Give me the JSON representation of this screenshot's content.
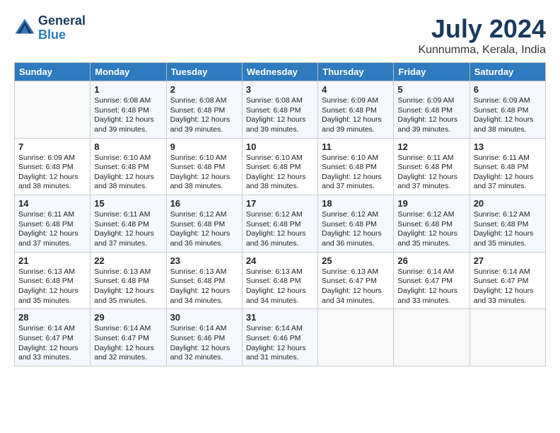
{
  "header": {
    "logo_general": "General",
    "logo_blue": "Blue",
    "month_title": "July 2024",
    "location": "Kunnumma, Kerala, India"
  },
  "days_of_week": [
    "Sunday",
    "Monday",
    "Tuesday",
    "Wednesday",
    "Thursday",
    "Friday",
    "Saturday"
  ],
  "weeks": [
    [
      {
        "day": "",
        "info": ""
      },
      {
        "day": "1",
        "info": "Sunrise: 6:08 AM\nSunset: 6:48 PM\nDaylight: 12 hours\nand 39 minutes."
      },
      {
        "day": "2",
        "info": "Sunrise: 6:08 AM\nSunset: 6:48 PM\nDaylight: 12 hours\nand 39 minutes."
      },
      {
        "day": "3",
        "info": "Sunrise: 6:08 AM\nSunset: 6:48 PM\nDaylight: 12 hours\nand 39 minutes."
      },
      {
        "day": "4",
        "info": "Sunrise: 6:09 AM\nSunset: 6:48 PM\nDaylight: 12 hours\nand 39 minutes."
      },
      {
        "day": "5",
        "info": "Sunrise: 6:09 AM\nSunset: 6:48 PM\nDaylight: 12 hours\nand 39 minutes."
      },
      {
        "day": "6",
        "info": "Sunrise: 6:09 AM\nSunset: 6:48 PM\nDaylight: 12 hours\nand 38 minutes."
      }
    ],
    [
      {
        "day": "7",
        "info": "Sunrise: 6:09 AM\nSunset: 6:48 PM\nDaylight: 12 hours\nand 38 minutes."
      },
      {
        "day": "8",
        "info": "Sunrise: 6:10 AM\nSunset: 6:48 PM\nDaylight: 12 hours\nand 38 minutes."
      },
      {
        "day": "9",
        "info": "Sunrise: 6:10 AM\nSunset: 6:48 PM\nDaylight: 12 hours\nand 38 minutes."
      },
      {
        "day": "10",
        "info": "Sunrise: 6:10 AM\nSunset: 6:48 PM\nDaylight: 12 hours\nand 38 minutes."
      },
      {
        "day": "11",
        "info": "Sunrise: 6:10 AM\nSunset: 6:48 PM\nDaylight: 12 hours\nand 37 minutes."
      },
      {
        "day": "12",
        "info": "Sunrise: 6:11 AM\nSunset: 6:48 PM\nDaylight: 12 hours\nand 37 minutes."
      },
      {
        "day": "13",
        "info": "Sunrise: 6:11 AM\nSunset: 6:48 PM\nDaylight: 12 hours\nand 37 minutes."
      }
    ],
    [
      {
        "day": "14",
        "info": "Sunrise: 6:11 AM\nSunset: 6:48 PM\nDaylight: 12 hours\nand 37 minutes."
      },
      {
        "day": "15",
        "info": "Sunrise: 6:11 AM\nSunset: 6:48 PM\nDaylight: 12 hours\nand 37 minutes."
      },
      {
        "day": "16",
        "info": "Sunrise: 6:12 AM\nSunset: 6:48 PM\nDaylight: 12 hours\nand 36 minutes."
      },
      {
        "day": "17",
        "info": "Sunrise: 6:12 AM\nSunset: 6:48 PM\nDaylight: 12 hours\nand 36 minutes."
      },
      {
        "day": "18",
        "info": "Sunrise: 6:12 AM\nSunset: 6:48 PM\nDaylight: 12 hours\nand 36 minutes."
      },
      {
        "day": "19",
        "info": "Sunrise: 6:12 AM\nSunset: 6:48 PM\nDaylight: 12 hours\nand 35 minutes."
      },
      {
        "day": "20",
        "info": "Sunrise: 6:12 AM\nSunset: 6:48 PM\nDaylight: 12 hours\nand 35 minutes."
      }
    ],
    [
      {
        "day": "21",
        "info": "Sunrise: 6:13 AM\nSunset: 6:48 PM\nDaylight: 12 hours\nand 35 minutes."
      },
      {
        "day": "22",
        "info": "Sunrise: 6:13 AM\nSunset: 6:48 PM\nDaylight: 12 hours\nand 35 minutes."
      },
      {
        "day": "23",
        "info": "Sunrise: 6:13 AM\nSunset: 6:48 PM\nDaylight: 12 hours\nand 34 minutes."
      },
      {
        "day": "24",
        "info": "Sunrise: 6:13 AM\nSunset: 6:48 PM\nDaylight: 12 hours\nand 34 minutes."
      },
      {
        "day": "25",
        "info": "Sunrise: 6:13 AM\nSunset: 6:47 PM\nDaylight: 12 hours\nand 34 minutes."
      },
      {
        "day": "26",
        "info": "Sunrise: 6:14 AM\nSunset: 6:47 PM\nDaylight: 12 hours\nand 33 minutes."
      },
      {
        "day": "27",
        "info": "Sunrise: 6:14 AM\nSunset: 6:47 PM\nDaylight: 12 hours\nand 33 minutes."
      }
    ],
    [
      {
        "day": "28",
        "info": "Sunrise: 6:14 AM\nSunset: 6:47 PM\nDaylight: 12 hours\nand 33 minutes."
      },
      {
        "day": "29",
        "info": "Sunrise: 6:14 AM\nSunset: 6:47 PM\nDaylight: 12 hours\nand 32 minutes."
      },
      {
        "day": "30",
        "info": "Sunrise: 6:14 AM\nSunset: 6:46 PM\nDaylight: 12 hours\nand 32 minutes."
      },
      {
        "day": "31",
        "info": "Sunrise: 6:14 AM\nSunset: 6:46 PM\nDaylight: 12 hours\nand 31 minutes."
      },
      {
        "day": "",
        "info": ""
      },
      {
        "day": "",
        "info": ""
      },
      {
        "day": "",
        "info": ""
      }
    ]
  ]
}
